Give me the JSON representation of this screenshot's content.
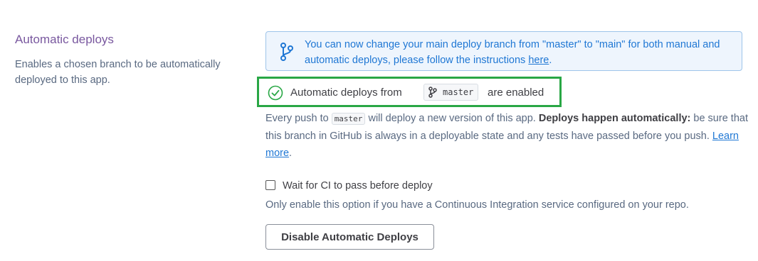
{
  "section": {
    "title": "Automatic deploys",
    "description": "Enables a chosen branch to be automatically deployed to this app."
  },
  "banner": {
    "icon": "git-branch-icon",
    "text_before": "You can now change your main deploy branch from \"master\" to \"main\" for both manual and automatic deploys, please follow the instructions ",
    "link_label": "here",
    "text_after": ".",
    "accent_color": "#1f77d4"
  },
  "status": {
    "icon": "check-circle-icon",
    "prefix": "Automatic deploys from",
    "branch": "master",
    "suffix": "are enabled",
    "highlight_color": "#29a745"
  },
  "push_info": {
    "text_1": "Every push to ",
    "branch": "master",
    "text_2": " will deploy a new version of this app. ",
    "bold": "Deploys happen automatically:",
    "text_3": " be sure that this branch in GitHub is always in a deployable state and any tests have passed before you push. ",
    "link_label": "Learn more",
    "text_4": "."
  },
  "ci_option": {
    "checked": false,
    "label": "Wait for CI to pass before deploy",
    "help": "Only enable this option if you have a Continuous Integration service configured on your repo."
  },
  "actions": {
    "disable_label": "Disable Automatic Deploys"
  }
}
